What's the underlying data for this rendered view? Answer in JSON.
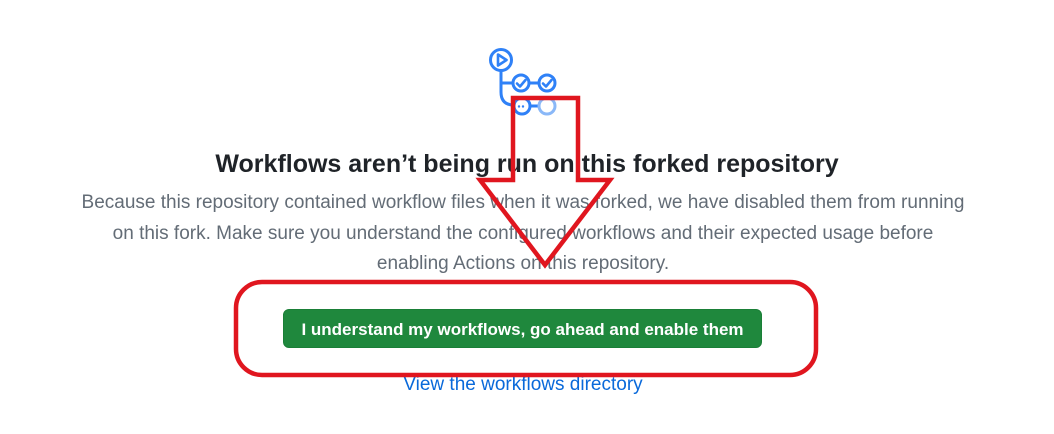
{
  "empty_state": {
    "title": "Workflows aren’t being run on this forked repository",
    "description": "Because this repository contained workflow files when it was forked, we have disabled them from running on this fork. Make sure you understand the configured workflows and their expected usage before enabling Actions on this repository.",
    "enable_button_label": "I understand my workflows, go ahead and enable them",
    "workflows_link_label": "View the workflows directory",
    "icon": "workflow-icon"
  },
  "annotation": {
    "highlight_color": "#e0161f",
    "shapes": [
      "down-arrow",
      "rounded-rectangle-highlight"
    ]
  },
  "colors": {
    "button_green": "#1f883d",
    "link_blue": "#0969da",
    "icon_blue": "#2f81f7"
  }
}
